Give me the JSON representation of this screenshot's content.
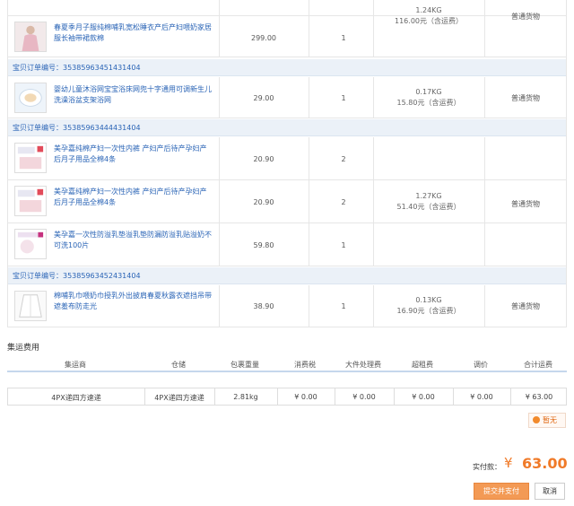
{
  "rows_top": {
    "top_item": {
      "name": "春夏季月子服纯棉哺乳宽松睡衣产后产妇喂奶家居服长袖带裙款棉",
      "price": "299.00",
      "qty": "1"
    },
    "group_top": {
      "weight": "1.24KG",
      "fee": "116.00元（含运费）",
      "type": "普通货物"
    }
  },
  "orders": [
    {
      "order_label": "宝贝订单编号：",
      "order_no": "35385963451431404",
      "items": [
        {
          "name": "婴幼儿童沐浴网宝宝浴床网兜十字通用可调新生儿洗澡浴盆支架浴网",
          "price": "29.00",
          "qty": "1"
        }
      ],
      "weight": "0.17KG",
      "fee": "15.80元（含运费）",
      "type": "普通货物"
    },
    {
      "order_label": "宝贝订单编号：",
      "order_no": "35385963444431404",
      "items": [
        {
          "name": "美孕嘉纯棉产妇一次性内裤 产妇产后待产孕妇产后月子用品全棉4条",
          "price": "20.90",
          "qty": "2"
        },
        {
          "name": "美孕嘉纯棉产妇一次性内裤 产妇产后待产孕妇产后月子用品全棉4条",
          "price": "20.90",
          "qty": "2"
        },
        {
          "name": "美孕嘉一次性防溢乳垫溢乳垫防漏防溢乳贴溢奶不可洗100片",
          "price": "59.80",
          "qty": "1"
        }
      ],
      "weight": "1.27KG",
      "fee": "51.40元（含运费）",
      "type": "普通货物"
    },
    {
      "order_label": "宝贝订单编号：",
      "order_no": "35385963452431404",
      "items": [
        {
          "name": "棉哺乳巾喂奶巾授乳外出披肩春夏秋露衣遮挡吊带遮羞布防走光",
          "price": "38.90",
          "qty": "1"
        }
      ],
      "weight": "0.13KG",
      "fee": "16.90元（含运费）",
      "type": "普通货物"
    }
  ],
  "fees": {
    "title": "集运费用",
    "headers": [
      "集运商",
      "仓储",
      "包裹重量",
      "消费税",
      "大件处理费",
      "超租费",
      "调价",
      "合计运费"
    ],
    "values": [
      "4PX递四方速递",
      "4PX递四方速递",
      "2.81kg",
      "¥ 0.00",
      "¥ 0.00",
      "¥ 0.00",
      "¥ 0.00",
      "¥ 63.00"
    ]
  },
  "coupon_label": "暂无",
  "total": {
    "label": "实付款：",
    "currency": "¥",
    "value": "63.00"
  },
  "buttons": {
    "submit": "提交并支付",
    "cancel": "取消"
  },
  "colors": {
    "accent": "#f07a28",
    "link": "#2a64b6",
    "order_bar": "#ebf1f8"
  }
}
